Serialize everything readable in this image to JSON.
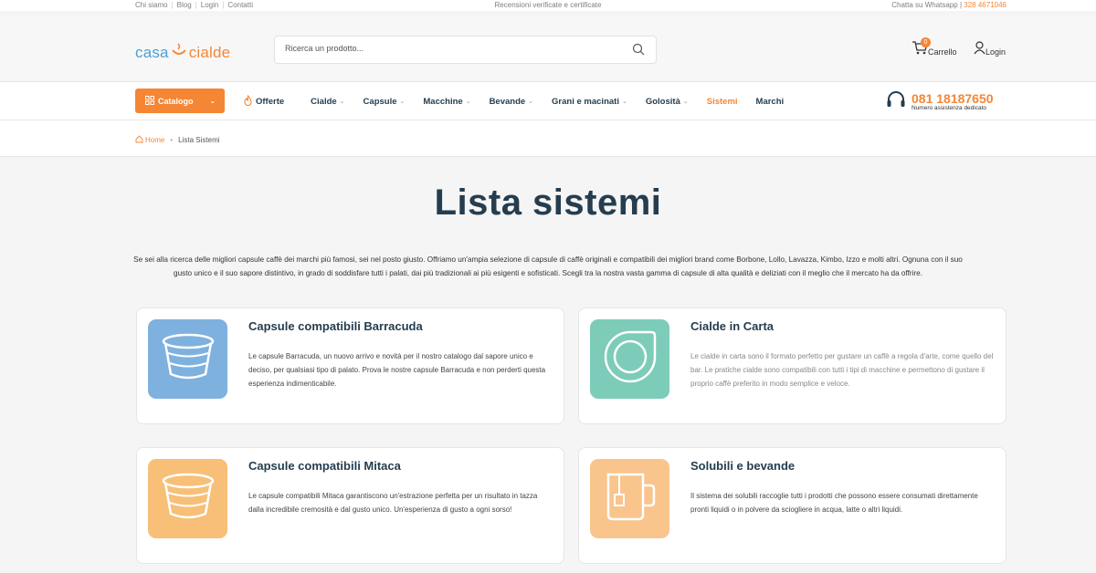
{
  "topbar": {
    "links": [
      "Chi siamo",
      "Blog",
      "Login",
      "Contatti"
    ],
    "center": "Recensioni verificate e certificate",
    "whatsapp_label": "Chatta su Whatsapp |",
    "whatsapp_number": "328 4671046"
  },
  "header": {
    "logo_left": "casa",
    "logo_right": "cialde",
    "search_placeholder": "Ricerca un prodotto...",
    "cart_label": "Carrello",
    "cart_count": "0",
    "login_label": "Login"
  },
  "nav": {
    "catalog_label": "Catalogo",
    "items": [
      {
        "label": "Offerte"
      },
      {
        "label": "Cialde"
      },
      {
        "label": "Capsule"
      },
      {
        "label": "Macchine"
      },
      {
        "label": "Bevande"
      },
      {
        "label": "Grani e macinati"
      },
      {
        "label": "Golosità"
      },
      {
        "label": "Sistemi"
      },
      {
        "label": "Marchi"
      }
    ],
    "phone_number": "081 18187650",
    "phone_sub": "Numero assistenza dedicato"
  },
  "breadcrumb": {
    "home": "Home",
    "current": "Lista Sistemi"
  },
  "main": {
    "title": "Lista sistemi",
    "intro": "Se sei alla ricerca delle migliori capsule caffè dei marchi più famosi, sei nel posto giusto. Offriamo un'ampia selezione di capsule di caffè originali e compatibili dei migliori brand come Borbone, Lollo, Lavazza, Kimbo, Izzo e molti altri. Ognuna con il suo gusto unico e il suo sapore distintivo, in grado di soddisfare tutti i palati, dai più tradizionali ai più esigenti e sofisticati. Scegli tra la nostra vasta gamma di capsule di alta qualità e deliziati con il meglio che il mercato ha da offrire.",
    "cards": [
      {
        "title": "Capsule compatibili Barracuda",
        "desc": "Le capsule Barracuda, un nuovo arrivo e novità per il nostro catalogo dal sapore unico e deciso, per qualsiasi tipo di palato. Prova le nostre capsule Barracuda e non perderti questa esperienza indimenticabile.",
        "color": "#7fb1de",
        "icon": "capsule-icon"
      },
      {
        "title": "Cialde in Carta",
        "desc": "Le cialde in carta sono il formato perfetto per gustare un caffè a regola d'arte, come quello del bar. Le pratiche cialde sono compatibili con tutti i tipi di macchine e permettono di gustare il proprio caffè preferito in modo semplice e veloce.",
        "color": "#7cccb9",
        "icon": "paper-pod-icon"
      },
      {
        "title": "Capsule compatibili Mitaca",
        "desc": "Le capsule compatibili Mitaca garantiscono un'estrazione perfetta per un risultato in tazza dalla incredibile cremosità e dal gusto unico. Un'esperienza di gusto a ogni sorso!",
        "color": "#f7bf77",
        "icon": "capsule-icon"
      },
      {
        "title": "Solubili e bevande",
        "desc": "Il sistema dei solubili raccoglie tutti i prodotti che possono essere consumati direttamente pronti liquidi o in polvere da sciogliere in acqua, latte o altri liquidi.",
        "color": "#f9c58d",
        "icon": "mug-icon"
      }
    ]
  }
}
